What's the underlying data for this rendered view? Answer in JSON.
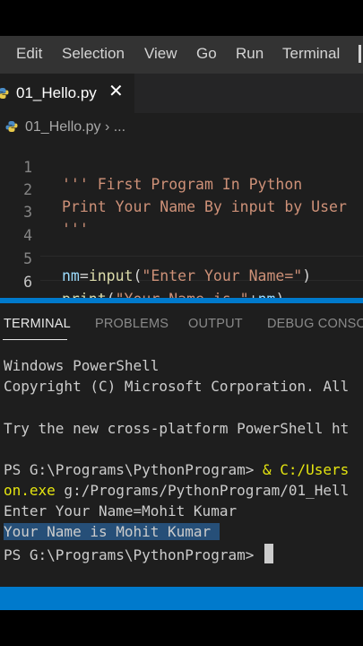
{
  "menu": {
    "items": [
      "Edit",
      "Selection",
      "View",
      "Go",
      "Run",
      "Terminal"
    ]
  },
  "tab": {
    "label": "01_Hello.py",
    "close_glyph": "✕"
  },
  "breadcrumb": {
    "file": "01_Hello.py",
    "separator": "›",
    "more": "..."
  },
  "editor": {
    "line_numbers": [
      "1",
      "2",
      "3",
      "4",
      "5",
      "6"
    ],
    "line1": "''' First Program In Python",
    "line2": "Print Your Name By input by User",
    "line3": "'''",
    "line5": {
      "var": "nm",
      "op": "=",
      "fn": "input",
      "open": "(",
      "str": "\"Enter Your Name=\"",
      "close": ")"
    },
    "line6": {
      "fn": "print",
      "open": "(",
      "str": "\"Your Name is \"",
      "op": "+",
      "var": "nm",
      "close": ")"
    }
  },
  "panel": {
    "tabs": [
      "TERMINAL",
      "PROBLEMS",
      "OUTPUT",
      "DEBUG CONSOL"
    ]
  },
  "terminal": {
    "l1": "Windows PowerShell",
    "l2": "Copyright (C) Microsoft Corporation. All",
    "l3": "Try the new cross-platform PowerShell ht",
    "l4a": "PS G:\\Programs\\PythonProgram> ",
    "l4b": "& C:/Users",
    "l5a": "on.exe",
    "l5b": " g:/Programs/PythonProgram/01_Hell",
    "l6": "Enter Your Name=Mohit Kumar",
    "l7": "Your Name is Mohit Kumar ",
    "l8": "PS G:\\Programs\\PythonProgram> "
  },
  "colors": {
    "accent": "#007acc",
    "string": "#ce9178",
    "variable": "#9cdcfe",
    "function": "#dcdcaa",
    "selection": "#264f78"
  }
}
